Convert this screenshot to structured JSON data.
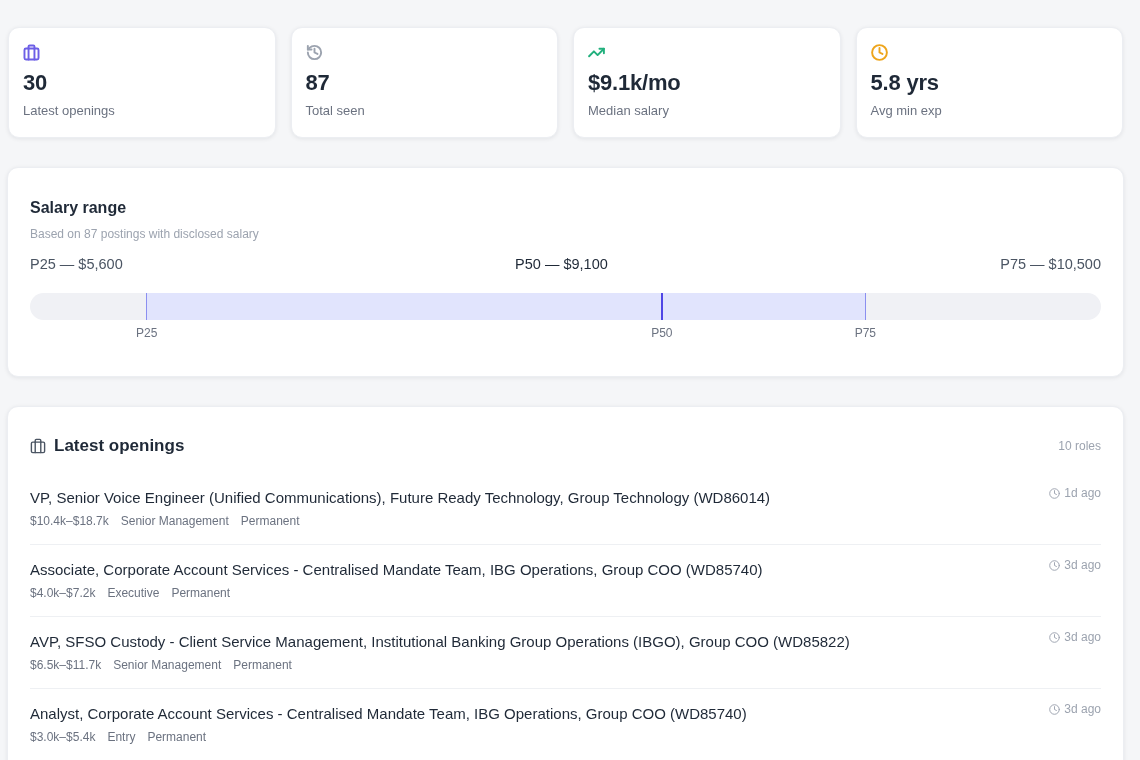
{
  "stats": [
    {
      "value": "30",
      "label": "Latest openings",
      "color": "#6d5fe6"
    },
    {
      "value": "87",
      "label": "Total seen",
      "color": "#9ca3af"
    },
    {
      "value": "$9.1k/mo",
      "label": "Median salary",
      "color": "#22b07d"
    },
    {
      "value": "5.8 yrs",
      "label": "Avg min exp",
      "color": "#eea51c"
    }
  ],
  "salary_range": {
    "title": "Salary range",
    "subtitle": "Based on 87 postings with disclosed salary",
    "markers": [
      {
        "label": "P25",
        "reading": "P25 — $5,600",
        "level": 0.109,
        "highlighted": false
      },
      {
        "label": "P50",
        "reading": "P50 — $9,100",
        "level": 0.59,
        "highlighted": true
      },
      {
        "label": "P75",
        "reading": "P75 — $10,500",
        "level": 0.78,
        "highlighted": false
      }
    ]
  },
  "openings": {
    "title": "Latest openings",
    "count": "10 roles",
    "items": [
      {
        "title": "VP, Senior Voice Engineer (Unified Communications), Future Ready Technology, Group Technology (WD86014)",
        "salary": "$10.4k–$18.7k",
        "seniority": "Senior Management",
        "employment_type": "Permanent",
        "posted": "1d ago"
      },
      {
        "title": "Associate, Corporate Account Services - Centralised Mandate Team, IBG Operations, Group COO (WD85740)",
        "salary": "$4.0k–$7.2k",
        "seniority": "Executive",
        "employment_type": "Permanent",
        "posted": "3d ago"
      },
      {
        "title": "AVP, SFSO Custody - Client Service Management, Institutional Banking Group Operations (IBGO), Group COO (WD85822)",
        "salary": "$6.5k–$11.7k",
        "seniority": "Senior Management",
        "employment_type": "Permanent",
        "posted": "3d ago"
      },
      {
        "title": "Analyst, Corporate Account Services - Centralised Mandate Team, IBG Operations, Group COO (WD85740)",
        "salary": "$3.0k–$5.4k",
        "seniority": "Entry",
        "employment_type": "Permanent",
        "posted": "3d ago"
      }
    ]
  }
}
